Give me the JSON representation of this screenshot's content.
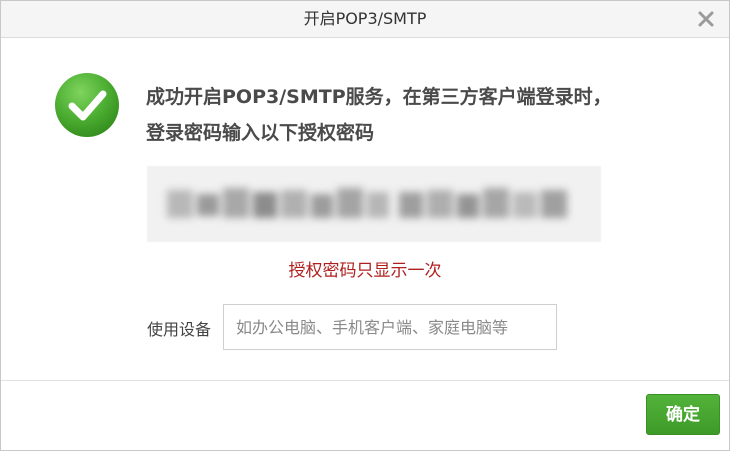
{
  "dialog": {
    "title": "开启POP3/SMTP",
    "close_icon": "close-icon"
  },
  "content": {
    "success_icon": "check-circle-icon",
    "message": "成功开启POP3/SMTP服务，在第三方客户端登录时，登录密码输入以下授权密码",
    "code_state": "blurred",
    "warning": "授权密码只显示一次"
  },
  "device": {
    "label": "使用设备",
    "placeholder": "如办公电脑、手机客户端、家庭电脑等",
    "value": ""
  },
  "footer": {
    "confirm_label": "确定"
  },
  "colors": {
    "accent_green": "#43a72c",
    "warning_red": "#b01f1f",
    "title_bar_bg": "#f5f5f5"
  }
}
